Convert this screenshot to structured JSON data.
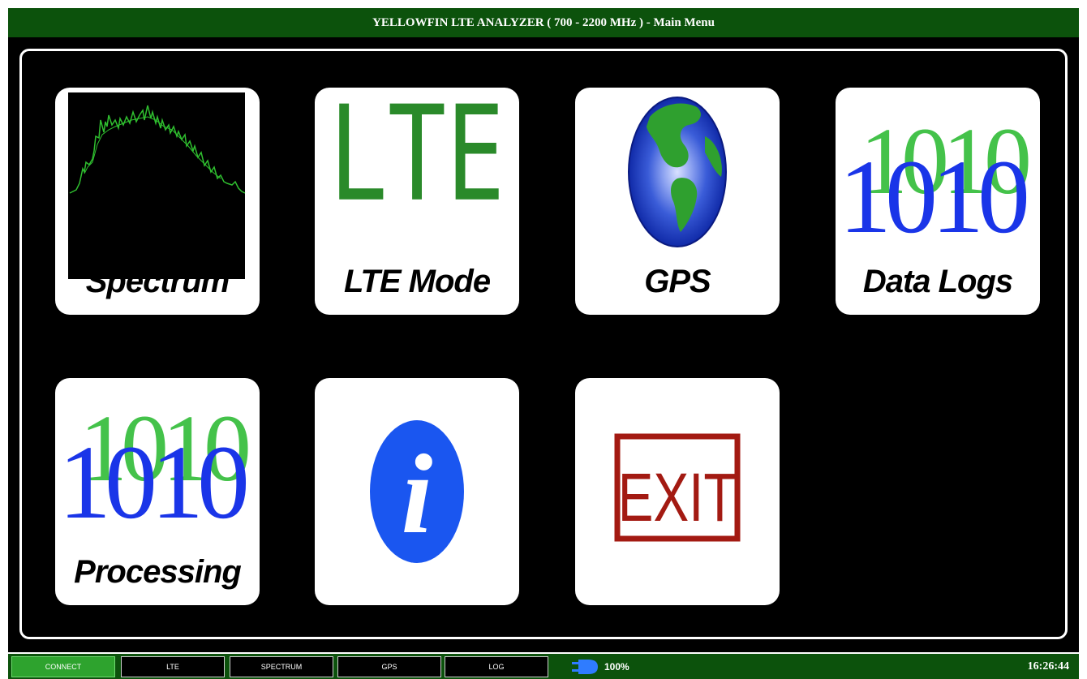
{
  "window": {
    "title": "YELLOWFIN LTE ANALYZER ( 700 - 2200 MHz ) - Main Menu"
  },
  "tiles": [
    {
      "label": "Spectrum",
      "icon": "spectrum-trace-icon"
    },
    {
      "label": "LTE Mode",
      "icon": "lte-text-icon",
      "icon_text": "LTE"
    },
    {
      "label": "GPS",
      "icon": "globe-icon"
    },
    {
      "label": "Data Logs",
      "icon": "binary-1010-icon",
      "icon_text": "1010"
    },
    {
      "label": "Processing",
      "icon": "binary-1010-icon",
      "icon_text": "1010"
    },
    {
      "label": "",
      "icon": "info-icon",
      "icon_text": "i"
    },
    {
      "label": "",
      "icon": "exit-sign-icon",
      "icon_text": "EXIT"
    }
  ],
  "status_bar": {
    "buttons": [
      {
        "label": "CONNECT",
        "active": true
      },
      {
        "label": "LTE",
        "active": false
      },
      {
        "label": "SPECTRUM",
        "active": false
      },
      {
        "label": "GPS",
        "active": false
      },
      {
        "label": "LOG",
        "active": false
      }
    ],
    "battery": "100%",
    "battery_icon": "battery-plug-icon",
    "time": "16:26:44"
  },
  "colors": {
    "title_bar": "#0c520c",
    "active_button": "#2ea32e",
    "lte_green": "#2a8a2a",
    "binary_blue": "#1a35e8",
    "binary_green": "#44c24a",
    "info_blue": "#1a56f0",
    "exit_red": "#a31a12"
  }
}
